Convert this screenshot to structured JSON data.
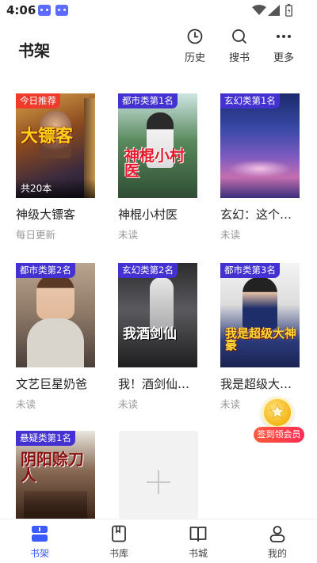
{
  "status_bar": {
    "time": "4:06"
  },
  "header": {
    "title": "书架",
    "actions": [
      {
        "label": "历史",
        "icon": "clock-icon"
      },
      {
        "label": "搜书",
        "icon": "search-icon"
      },
      {
        "label": "更多",
        "icon": "more-icon"
      }
    ]
  },
  "books": [
    {
      "title": "神级大镖客",
      "subtitle": "每日更新",
      "badge": "今日推荐",
      "badge_color": "#ef3b2c",
      "count": "共20本",
      "cover_text": "大镖客"
    },
    {
      "title": "神棍小村医",
      "subtitle": "未读",
      "badge": "都市类第1名",
      "badge_color": "#4332d1",
      "cover_text": "神棍小村医"
    },
    {
      "title": "玄幻：这个…",
      "subtitle": "未读",
      "badge": "玄幻类第1名",
      "badge_color": "#4332d1",
      "cover_text": ""
    },
    {
      "title": "文艺巨星奶爸",
      "subtitle": "未读",
      "badge": "都市类第2名",
      "badge_color": "#4332d1",
      "cover_text": ""
    },
    {
      "title": "我！酒剑仙…",
      "subtitle": "未读",
      "badge": "玄幻类第2名",
      "badge_color": "#4332d1",
      "cover_text": "我酒剑仙"
    },
    {
      "title": "我是超级大…",
      "subtitle": "未读",
      "badge": "都市类第3名",
      "badge_color": "#4332d1",
      "cover_text": "我是超级大神豪"
    },
    {
      "title": "",
      "subtitle": "",
      "badge": "悬疑类第1名",
      "badge_color": "#4332d1",
      "cover_text": "阴阳赊刀人"
    }
  ],
  "signin": {
    "label": "签到领会员"
  },
  "bottom_nav": [
    {
      "label": "书架",
      "active": true,
      "icon": "bookshelf-icon"
    },
    {
      "label": "书库",
      "active": false,
      "icon": "library-icon"
    },
    {
      "label": "书城",
      "active": false,
      "icon": "book-open-icon"
    },
    {
      "label": "我的",
      "active": false,
      "icon": "profile-icon"
    }
  ],
  "colors": {
    "accent": "#3b5bff",
    "rank_badge": "#4332d1",
    "recommend_badge": "#ef3b2c",
    "signin": "#ff2d55"
  }
}
